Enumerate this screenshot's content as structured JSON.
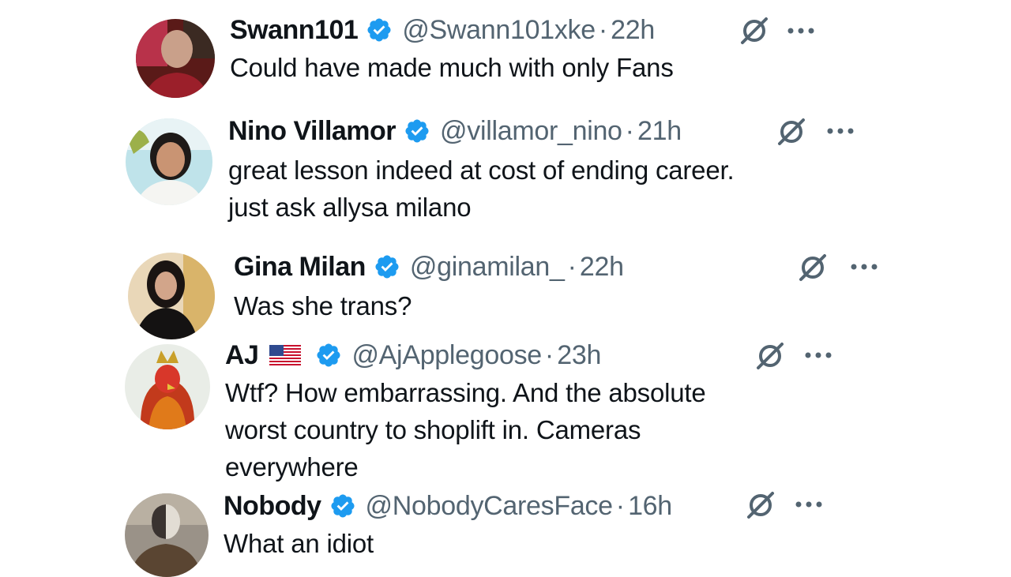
{
  "replies": [
    {
      "name": "Swann101",
      "handle": "@Swann101xke",
      "separator": "·",
      "time": "22h",
      "verified": true,
      "flag": "",
      "text": "Could have made much with only Fans",
      "grok_icon": "grok-icon",
      "more_icon": "more-icon"
    },
    {
      "name": "Nino Villamor",
      "handle": "@villamor_nino",
      "separator": "·",
      "time": "21h",
      "verified": true,
      "flag": "",
      "text": "great lesson indeed at cost of ending career.\njust ask allysa milano",
      "grok_icon": "grok-icon",
      "more_icon": "more-icon"
    },
    {
      "name": "Gina Milan",
      "handle": "@ginamilan_",
      "separator": "·",
      "time": "22h",
      "verified": true,
      "flag": "",
      "text": "Was she trans?",
      "grok_icon": "grok-icon",
      "more_icon": "more-icon"
    },
    {
      "name": "AJ",
      "handle": "@AjApplegoose",
      "separator": "·",
      "time": "23h",
      "verified": true,
      "flag": "us-flag-emoji",
      "text": "Wtf? How embarrassing. And the absolute\nworst country to shoplift in. Cameras\neverywhere",
      "grok_icon": "grok-icon",
      "more_icon": "more-icon"
    },
    {
      "name": "Nobody",
      "handle": "@NobodyCaresFace",
      "separator": "·",
      "time": "16h",
      "verified": true,
      "flag": "",
      "text": "What an idiot",
      "grok_icon": "grok-icon",
      "more_icon": "more-icon"
    }
  ],
  "colors": {
    "text": "#0f1419",
    "secondary": "#536471",
    "verified_blue": "#1d9bf0",
    "icon_gray": "#536471"
  }
}
